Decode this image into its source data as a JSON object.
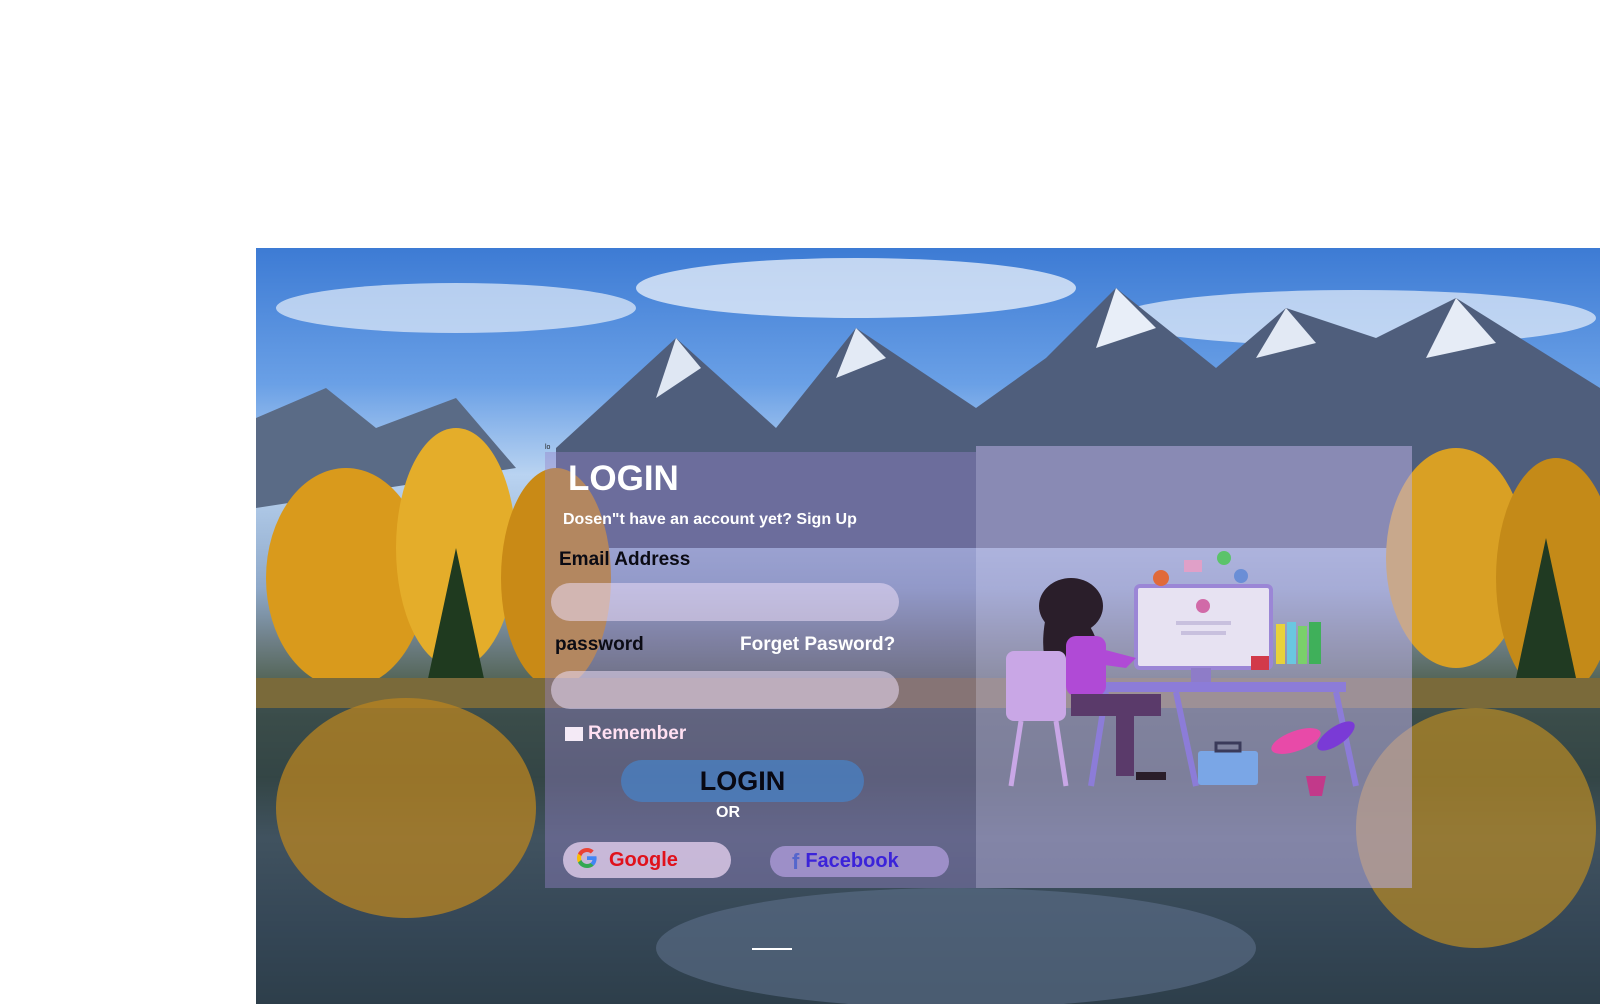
{
  "scene": {
    "description_icon": "mountain-lake-background"
  },
  "login": {
    "small_mark": "lo",
    "title": "LOGIN",
    "signup_text": "Dosen\"t have an account yet? Sign Up",
    "email_label": "Email Address",
    "email_value": "",
    "password_label": "password",
    "password_value": "",
    "forgot_label": "Forget Pasword?",
    "remember_label": "Remember",
    "submit_label": "LOGIN",
    "or_text": "OR",
    "google_label": "Google",
    "facebook_label": "Facebook"
  },
  "illustration": {
    "icon": "woman-at-desk-illustration"
  },
  "colors": {
    "google_text": "#e0111b",
    "facebook_text": "#3b23d9",
    "login_button": "#4682c8"
  }
}
